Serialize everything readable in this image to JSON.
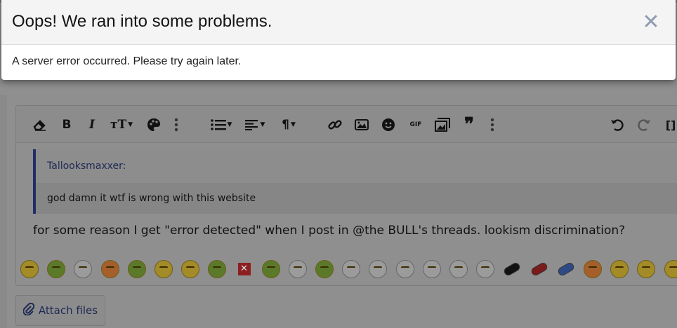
{
  "modal": {
    "title": "Oops! We ran into some problems.",
    "close_icon": "close-icon",
    "message": "A server error occurred. Please try again later."
  },
  "toolbar": {
    "buttons": [
      {
        "name": "clear-formatting",
        "icon": "eraser-icon"
      },
      {
        "name": "bold",
        "label": "B"
      },
      {
        "name": "italic",
        "label": "I"
      },
      {
        "name": "font-size",
        "label": "тT"
      },
      {
        "name": "text-color",
        "icon": "palette-icon"
      },
      {
        "name": "more-text",
        "icon": "vertical-dots-icon"
      },
      {
        "name": "list",
        "icon": "list-icon"
      },
      {
        "name": "align",
        "icon": "align-left-icon"
      },
      {
        "name": "paragraph",
        "label": "¶"
      },
      {
        "name": "link",
        "icon": "link-icon"
      },
      {
        "name": "image",
        "icon": "image-icon"
      },
      {
        "name": "emoji",
        "icon": "smiley-icon"
      },
      {
        "name": "gif",
        "label": "GIF"
      },
      {
        "name": "media",
        "icon": "media-icon"
      },
      {
        "name": "quote",
        "label": "❞"
      },
      {
        "name": "more-insert",
        "icon": "vertical-dots-icon"
      },
      {
        "name": "undo",
        "icon": "undo-icon"
      },
      {
        "name": "redo",
        "icon": "redo-icon"
      },
      {
        "name": "toggle-bbcode",
        "label": "[]"
      }
    ]
  },
  "editor": {
    "quote_author": "Tallooksmaxxer:",
    "quote_text": "god damn it wtf is wrong with this website",
    "post_text": "for some reason I get \"error detected\" when I post in @the BULL's threads. lookism discrimination?"
  },
  "emoji_bar": [
    "starstruck-emoji",
    "pepe-emoji",
    "wojak-emoji",
    "heart-eyes-emoji",
    "pepe-emoji",
    "money-mouth-emoji",
    "pleading-emoji",
    "pepe-emoji",
    "cross-mark-emoji",
    "nauseated-emoji",
    "wojak-emoji",
    "shrek-emoji",
    "wojak-emoji",
    "wojak-emoji",
    "wojak-emoji",
    "wojak-emoji",
    "wojak-emoji",
    "wojak-emoji",
    "black-pill-emoji",
    "red-pill-emoji",
    "blue-pill-emoji",
    "grimace-emoji",
    "smile-emoji",
    "tongue-emoji",
    "grin-emoji"
  ],
  "attach": {
    "label": "Attach files",
    "icon": "paperclip-icon"
  }
}
